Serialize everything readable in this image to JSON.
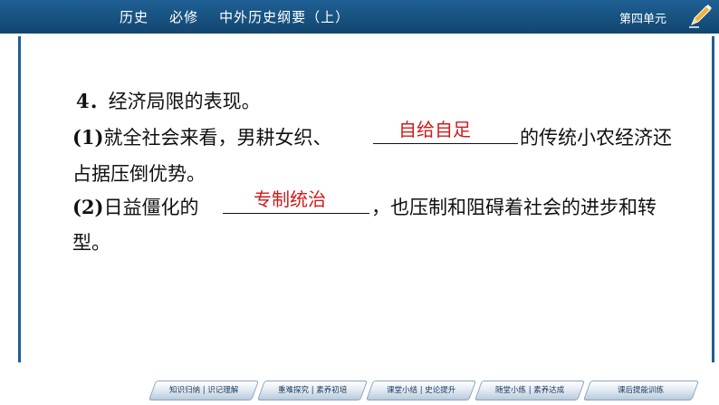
{
  "header": {
    "title": "历史    必修    中外历史纲要（上）",
    "unit": "第四单元"
  },
  "content": {
    "heading_num": "4．",
    "heading_text": "经济局限的表现。",
    "item1_num": "(1)",
    "item1_pre": "就全社会来看，男耕女织、",
    "item1_answer": "自给自足",
    "item1_post": "的传统小农经济还",
    "item1_cont": "占据压倒优势。",
    "item2_num": "(2)",
    "item2_pre": "日益僵化的",
    "item2_answer": "专制统治",
    "item2_post": "，也压制和阻碍着社会的进步和转",
    "item2_cont": "型。"
  },
  "nav": [
    {
      "label": "知识归纳 | 识记理解"
    },
    {
      "label": "重难探究 | 素养初培"
    },
    {
      "label": "课堂小结 | 史论提升"
    },
    {
      "label": "随堂小练 | 素养达成"
    },
    {
      "label": "课后提能训练"
    }
  ],
  "colors": {
    "header": "#17527f",
    "answer": "#d21a1a"
  },
  "icons": {
    "pencil": "pencil-icon"
  }
}
